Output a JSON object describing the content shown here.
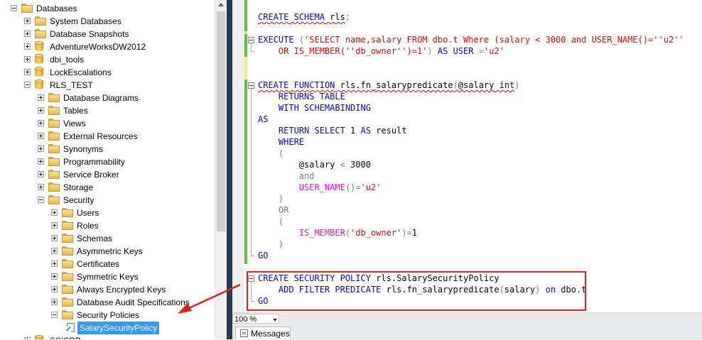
{
  "explorer": {
    "items": [
      {
        "label": "Databases",
        "icon": "folder",
        "expander": "minus",
        "level": 0
      },
      {
        "label": "System Databases",
        "icon": "folder",
        "expander": "plus",
        "level": 1
      },
      {
        "label": "Database Snapshots",
        "icon": "folder",
        "expander": "plus",
        "level": 1
      },
      {
        "label": "AdventureWorksDW2012",
        "icon": "database",
        "expander": "plus",
        "level": 1
      },
      {
        "label": "dbi_tools",
        "icon": "database",
        "expander": "plus",
        "level": 1
      },
      {
        "label": "LockEscalations",
        "icon": "database",
        "expander": "plus",
        "level": 1
      },
      {
        "label": "RLS_TEST",
        "icon": "database",
        "expander": "minus",
        "level": 1
      },
      {
        "label": "Database Diagrams",
        "icon": "folder",
        "expander": "plus",
        "level": 2
      },
      {
        "label": "Tables",
        "icon": "folder",
        "expander": "plus",
        "level": 2
      },
      {
        "label": "Views",
        "icon": "folder",
        "expander": "plus",
        "level": 2
      },
      {
        "label": "External Resources",
        "icon": "folder",
        "expander": "plus",
        "level": 2
      },
      {
        "label": "Synonyms",
        "icon": "folder",
        "expander": "plus",
        "level": 2
      },
      {
        "label": "Programmability",
        "icon": "folder",
        "expander": "plus",
        "level": 2
      },
      {
        "label": "Service Broker",
        "icon": "folder",
        "expander": "plus",
        "level": 2
      },
      {
        "label": "Storage",
        "icon": "folder",
        "expander": "plus",
        "level": 2
      },
      {
        "label": "Security",
        "icon": "folder",
        "expander": "minus",
        "level": 2
      },
      {
        "label": "Users",
        "icon": "folder",
        "expander": "plus",
        "level": 3
      },
      {
        "label": "Roles",
        "icon": "folder",
        "expander": "plus",
        "level": 3
      },
      {
        "label": "Schemas",
        "icon": "folder",
        "expander": "plus",
        "level": 3
      },
      {
        "label": "Asymmetric Keys",
        "icon": "folder",
        "expander": "plus",
        "level": 3
      },
      {
        "label": "Certificates",
        "icon": "folder",
        "expander": "plus",
        "level": 3
      },
      {
        "label": "Symmetric Keys",
        "icon": "folder",
        "expander": "plus",
        "level": 3
      },
      {
        "label": "Always Encrypted Keys",
        "icon": "folder",
        "expander": "plus",
        "level": 3
      },
      {
        "label": "Database Audit Specifications",
        "icon": "folder",
        "expander": "plus",
        "level": 3
      },
      {
        "label": "Security Policies",
        "icon": "folder",
        "expander": "minus",
        "level": 3
      },
      {
        "label": "SalarySecurityPolicy",
        "icon": "policy",
        "expander": "none",
        "level": 4,
        "selected": true
      },
      {
        "label": "SSISDB",
        "icon": "database",
        "expander": "plus",
        "level": 1
      }
    ]
  },
  "editor": {
    "lines": [
      {
        "row": 1,
        "tokens": [
          {
            "t": "CREATE",
            "c": "kw sq"
          },
          {
            "t": " ",
            "c": "sq"
          },
          {
            "t": "SCHEMA",
            "c": "kw sq"
          },
          {
            "t": " rls",
            "c": "sq"
          },
          {
            "t": ";",
            "c": "gray"
          }
        ]
      },
      {
        "row": 3,
        "fold": true,
        "tokens": [
          {
            "t": "EXECUTE",
            "c": "kw"
          },
          {
            "t": " (",
            "c": "gray"
          },
          {
            "t": "'SELECT name,salary FROM dbo.t Where (salary < 3000 and USER_NAME()=''u2''",
            "c": "str"
          }
        ]
      },
      {
        "row": 4,
        "tokens": [
          {
            "t": "    OR IS_MEMBER(''db_owner'')=1'",
            "c": "str"
          },
          {
            "t": ") ",
            "c": "gray"
          },
          {
            "t": "AS",
            "c": "kw"
          },
          {
            "t": " ",
            "c": ""
          },
          {
            "t": "USER",
            "c": "kw"
          },
          {
            "t": " =",
            "c": "gray"
          },
          {
            "t": "'u2'",
            "c": "str"
          }
        ]
      },
      {
        "row": 7,
        "fold": true,
        "tokens": [
          {
            "t": "CREATE",
            "c": "kw sq"
          },
          {
            "t": " ",
            "c": "sq"
          },
          {
            "t": "FUNCTION",
            "c": "kw sq"
          },
          {
            "t": " rls.fn_salarypredicate",
            "c": "sq"
          },
          {
            "t": "(",
            "c": "gray sq"
          },
          {
            "t": "@salary",
            "c": "sq"
          },
          {
            "t": " ",
            "c": "sq"
          },
          {
            "t": "int",
            "c": "kw sq"
          },
          {
            "t": ")",
            "c": "gray"
          }
        ]
      },
      {
        "row": 8,
        "tokens": [
          {
            "t": "    RETURNS TABLE",
            "c": "kw"
          }
        ]
      },
      {
        "row": 9,
        "tokens": [
          {
            "t": "    WITH SCHEMABINDING",
            "c": "kw"
          }
        ]
      },
      {
        "row": 10,
        "tokens": [
          {
            "t": "AS",
            "c": "kw"
          }
        ]
      },
      {
        "row": 11,
        "tokens": [
          {
            "t": "    RETURN SELECT",
            "c": "kw"
          },
          {
            "t": " 1 ",
            "c": ""
          },
          {
            "t": "AS",
            "c": "kw"
          },
          {
            "t": " result",
            "c": ""
          }
        ]
      },
      {
        "row": 12,
        "tokens": [
          {
            "t": "    WHERE",
            "c": "kw"
          }
        ]
      },
      {
        "row": 13,
        "tokens": [
          {
            "t": "    (",
            "c": "gray"
          }
        ]
      },
      {
        "row": 14,
        "tokens": [
          {
            "t": "        @salary ",
            "c": ""
          },
          {
            "t": "<",
            "c": "gray"
          },
          {
            "t": " 3000",
            "c": ""
          }
        ]
      },
      {
        "row": 15,
        "tokens": [
          {
            "t": "        and",
            "c": "gray"
          }
        ]
      },
      {
        "row": 16,
        "tokens": [
          {
            "t": "        USER_NAME",
            "c": "fn"
          },
          {
            "t": "()=",
            "c": "gray"
          },
          {
            "t": "'u2'",
            "c": "str"
          }
        ]
      },
      {
        "row": 17,
        "tokens": [
          {
            "t": "    )",
            "c": "gray"
          }
        ]
      },
      {
        "row": 18,
        "tokens": [
          {
            "t": "    OR",
            "c": "gray"
          }
        ]
      },
      {
        "row": 19,
        "tokens": [
          {
            "t": "    (",
            "c": "gray"
          }
        ]
      },
      {
        "row": 20,
        "tokens": [
          {
            "t": "        IS_MEMBER",
            "c": "fn"
          },
          {
            "t": "(",
            "c": "gray"
          },
          {
            "t": "'db_owner'",
            "c": "str"
          },
          {
            "t": ")=",
            "c": "gray"
          },
          {
            "t": "1",
            "c": ""
          }
        ]
      },
      {
        "row": 21,
        "tokens": [
          {
            "t": "    )",
            "c": "gray"
          }
        ]
      },
      {
        "row": 22,
        "tokens": [
          {
            "t": "GO",
            "c": "kw"
          }
        ]
      },
      {
        "row": 24,
        "fold": true,
        "tokens": [
          {
            "t": "CREATE SECURITY POLICY",
            "c": "kw"
          },
          {
            "t": " rls.SalarySecurityPolicy",
            "c": ""
          }
        ]
      },
      {
        "row": 25,
        "tokens": [
          {
            "t": "    ADD FILTER PREDICATE",
            "c": "kw"
          },
          {
            "t": " rls.fn_salarypredicate",
            "c": ""
          },
          {
            "t": "(",
            "c": "gray"
          },
          {
            "t": "salary",
            "c": ""
          },
          {
            "t": ") ",
            "c": "gray"
          },
          {
            "t": "on",
            "c": "kw"
          },
          {
            "t": " dbo.t",
            "c": ""
          }
        ]
      },
      {
        "row": 26,
        "tokens": [
          {
            "t": "GO",
            "c": "kw"
          }
        ]
      }
    ]
  },
  "statusbar": {
    "zoom": "100 %"
  },
  "results_tabs": {
    "messages_label": "Messages"
  },
  "colors": {
    "highlight_box": "#e02020",
    "annotation_arrow": "#e02020",
    "selection": "#3399ff"
  }
}
